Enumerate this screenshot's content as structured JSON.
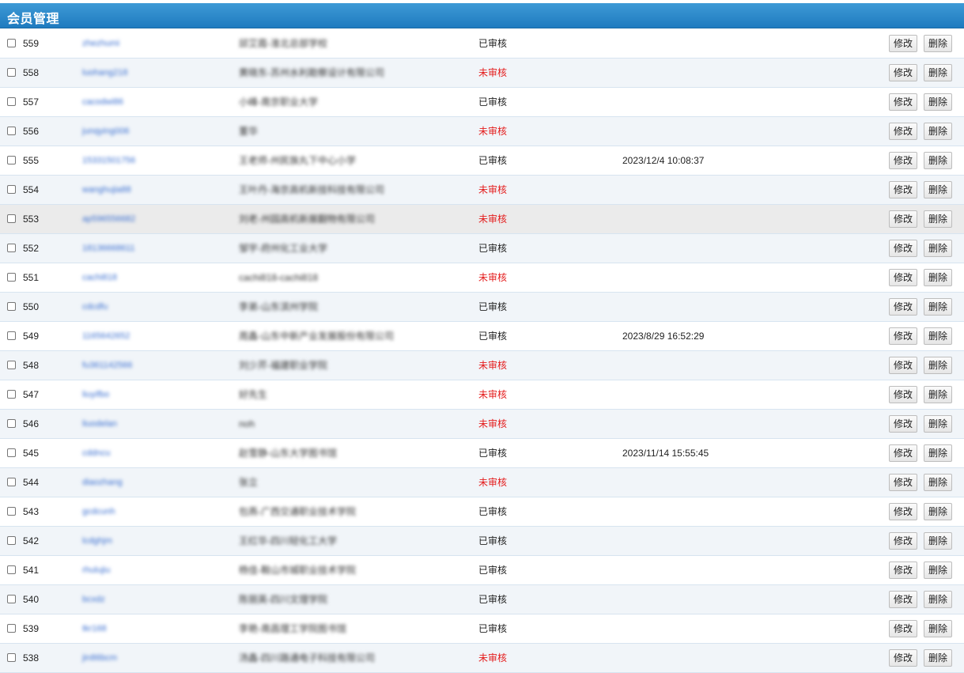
{
  "header": {
    "title": "会员管理"
  },
  "actions": {
    "edit_label": "修改",
    "delete_label": "删除"
  },
  "rows": [
    {
      "id": "559",
      "username": "zhezhumi",
      "company": "邱艾霞-淮北总部学校",
      "status": "已审核",
      "status_kind": "ok",
      "time": ""
    },
    {
      "id": "558",
      "username": "luohang218",
      "company": "黄晓东-苏州水利勘察设计有限公司",
      "status": "未审核",
      "status_kind": "no",
      "time": ""
    },
    {
      "id": "557",
      "username": "cacodwi86",
      "company": "小峰-南京职业大学",
      "status": "已审核",
      "status_kind": "ok",
      "time": ""
    },
    {
      "id": "556",
      "username": "junqying006",
      "company": "董华",
      "status": "未审核",
      "status_kind": "no",
      "time": ""
    },
    {
      "id": "555",
      "username": "15331501756",
      "company": "王老师-州民族丸下中心小学",
      "status": "已审核",
      "status_kind": "ok",
      "time": "2023/12/4 10:08:37"
    },
    {
      "id": "554",
      "username": "wanghujia88",
      "company": "王叶丹-海京高机新技科技有限公司",
      "status": "未审核",
      "status_kind": "no",
      "time": ""
    },
    {
      "id": "553",
      "username": "ap596556682",
      "company": "刘老-州园高机新展翻物有限公司",
      "status": "未审核",
      "status_kind": "no",
      "time": ""
    },
    {
      "id": "552",
      "username": "18136668611",
      "company": "邹宇-府州化工业大学",
      "status": "已审核",
      "status_kind": "ok",
      "time": ""
    },
    {
      "id": "551",
      "username": "cachi818",
      "company": "cachi818-cachi818",
      "status": "未审核",
      "status_kind": "no",
      "time": ""
    },
    {
      "id": "550",
      "username": "cdcdfu",
      "company": "李弟-山东滨州学院",
      "status": "已审核",
      "status_kind": "ok",
      "time": ""
    },
    {
      "id": "549",
      "username": "1165642652",
      "company": "周鑫-山东中新产业发展股份有限公司",
      "status": "已审核",
      "status_kind": "ok",
      "time": "2023/8/29 16:52:29"
    },
    {
      "id": "548",
      "username": "fu361142566",
      "company": "刘少芹-福建职业学院",
      "status": "未审核",
      "status_kind": "no",
      "time": ""
    },
    {
      "id": "547",
      "username": "liuyifbo",
      "company": "好先生",
      "status": "未审核",
      "status_kind": "no",
      "time": ""
    },
    {
      "id": "546",
      "username": "liuodelan",
      "company": "noh",
      "status": "未审核",
      "status_kind": "no",
      "time": ""
    },
    {
      "id": "545",
      "username": "cddncu",
      "company": "赵雪静-山东大学图书馆",
      "status": "已审核",
      "status_kind": "ok",
      "time": "2023/11/14 15:55:45"
    },
    {
      "id": "544",
      "username": "diaozhang",
      "company": "张立",
      "status": "未审核",
      "status_kind": "no",
      "time": ""
    },
    {
      "id": "543",
      "username": "gcdcunh",
      "company": "包燕-广西交通职业技术学院",
      "status": "已审核",
      "status_kind": "ok",
      "time": ""
    },
    {
      "id": "542",
      "username": "lcdghjm",
      "company": "王红华-四川轻化工大学",
      "status": "已审核",
      "status_kind": "ok",
      "time": ""
    },
    {
      "id": "541",
      "username": "rhulujiu",
      "company": "杨佳-鞍山市城职业技术学院",
      "status": "已审核",
      "status_kind": "ok",
      "time": ""
    },
    {
      "id": "540",
      "username": "bcxdz",
      "company": "陈丽英-四川文理学院",
      "status": "已审核",
      "status_kind": "ok",
      "time": ""
    },
    {
      "id": "539",
      "username": "tkr168",
      "company": "李艳-南昌理工学院图书馆",
      "status": "已审核",
      "status_kind": "ok",
      "time": ""
    },
    {
      "id": "538",
      "username": "jin86bcm",
      "company": "汤鑫-四川路通电子科技有限公司",
      "status": "未审核",
      "status_kind": "no",
      "time": ""
    }
  ]
}
